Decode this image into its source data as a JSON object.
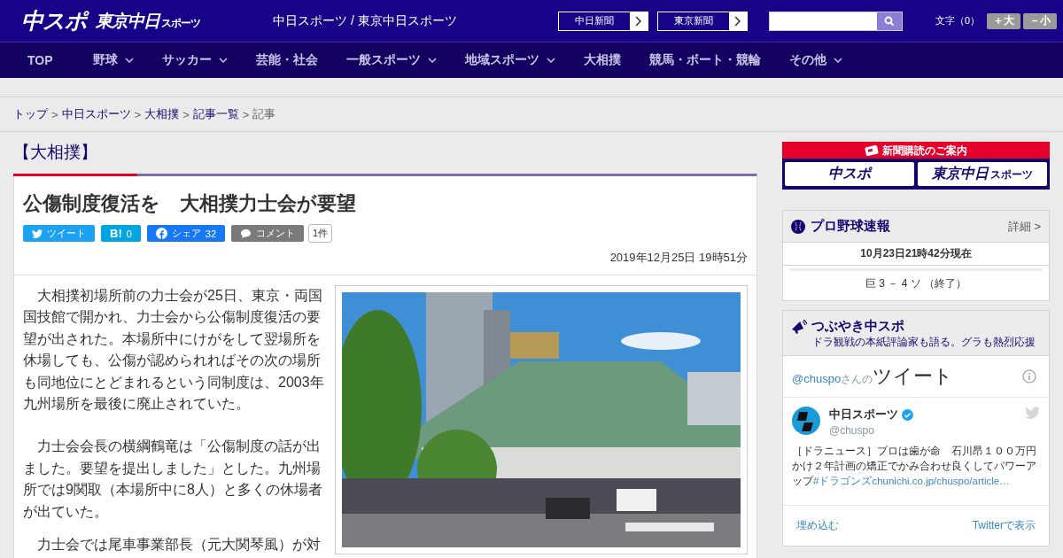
{
  "header": {
    "logo_main": "中スポ",
    "logo_sub": "東京中日",
    "logo_sub_small": "スポーツ",
    "site_title": "中日スポーツ / 東京中日スポーツ",
    "paper_links": [
      "中日新聞",
      "東京新聞"
    ],
    "text_size_label": "文字（0）",
    "text_size_buttons": [
      "＋大",
      "－小"
    ]
  },
  "nav": [
    {
      "label": "TOP",
      "dropdown": false
    },
    {
      "label": "野球",
      "dropdown": true
    },
    {
      "label": "サッカー",
      "dropdown": true
    },
    {
      "label": "芸能・社会",
      "dropdown": false
    },
    {
      "label": "一般スポーツ",
      "dropdown": true
    },
    {
      "label": "地域スポーツ",
      "dropdown": true
    },
    {
      "label": "大相撲",
      "dropdown": false
    },
    {
      "label": "競馬・ボート・競輪",
      "dropdown": false
    },
    {
      "label": "その他",
      "dropdown": true
    }
  ],
  "breadcrumb": [
    {
      "label": "トップ",
      "link": true
    },
    {
      "separator": ">",
      "label": "中日スポーツ",
      "link": true
    },
    {
      "separator": ">",
      "label": "大相撲",
      "link": true
    },
    {
      "separator": ">",
      "label": "記事一覧",
      "link": true
    },
    {
      "separator": ">",
      "label": "記事",
      "link": false
    }
  ],
  "category": "【大相撲】",
  "article": {
    "title": "公傷制度復活を　大相撲力士会が要望",
    "share": [
      {
        "kind": "twitter",
        "label": "ツイート"
      },
      {
        "kind": "hatena",
        "label": "B!",
        "count": "0"
      },
      {
        "kind": "facebook",
        "label": "シェア",
        "count": "32"
      },
      {
        "kind": "comment",
        "label": "コメント"
      }
    ],
    "comment_count": "1件",
    "date": "2019年12月25日 19時51分",
    "paragraphs": [
      "大相撲初場所前の力士会が25日、東京・両国国技館で開かれ、力士会から公傷制度復活の要望が出された。本場所中にけがをして翌場所を休場しても、公傷が認められればその次の場所も同地位にとどまれるという同制度は、2003年九州場所を最後に廃止されていた。",
      "力士会会長の横綱鶴竜は「公傷制度の話が出ました。要望を提出しました」とした。九州場所では9関取（本場所中に8人）と多くの休場者が出ていた。",
      "力士会では尾車事業部長（元大関琴風）が対"
    ]
  },
  "sidebar": {
    "subscribe": {
      "title": "新聞購読のご案内",
      "logos": [
        "中スポ",
        "東京中日"
      ],
      "logo_sub_small": "スポーツ"
    },
    "baseball": {
      "title": "プロ野球速報",
      "more": "詳細 >",
      "updated": "10月23日21時42分現在",
      "result": "巨 3 － 4 ソ （終了）"
    },
    "tweets": {
      "title": "つぶやき中スポ",
      "subtitle": "ドラ観戦の本紙評論家も語る。グラも熱烈応援",
      "handle_link": "@chuspo",
      "handle_suffix": "さんの",
      "heading": "ツイート",
      "tweet": {
        "name": "中日スポーツ",
        "verified": true,
        "handle": "@chuspo",
        "text": "［ドラニュース］プロは歯が命　石川昂１００万円かけ２年計画の矯正でかみ合わせ良くしてパワーアップ",
        "hashtag": "#ドラゴンズ",
        "link": "chunichi.co.jp/chuspo/article…"
      },
      "footer": [
        "埋め込む",
        "Twitterで表示"
      ]
    }
  }
}
